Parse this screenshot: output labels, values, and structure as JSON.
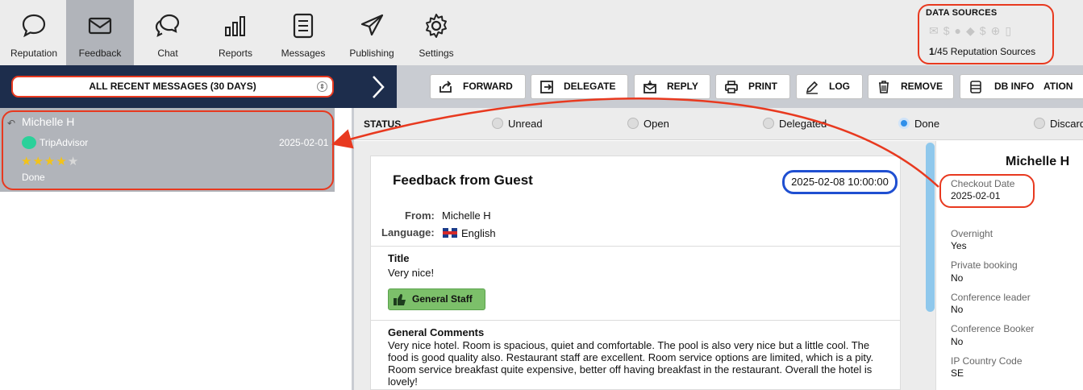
{
  "nav": {
    "items": [
      {
        "label": "Reputation",
        "icon": "speech-bubble-icon"
      },
      {
        "label": "Feedback",
        "icon": "envelope-icon"
      },
      {
        "label": "Chat",
        "icon": "chat-bubbles-icon"
      },
      {
        "label": "Reports",
        "icon": "bar-chart-icon"
      },
      {
        "label": "Messages",
        "icon": "document-icon"
      },
      {
        "label": "Publishing",
        "icon": "paper-plane-icon"
      },
      {
        "label": "Settings",
        "icon": "gear-icon"
      }
    ],
    "active": "Feedback"
  },
  "data_sources": {
    "title": "DATA SOURCES",
    "active_count": "1",
    "count_rest": "/45 Reputation Sources"
  },
  "toolbar": {
    "filter_label": "ALL RECENT MESSAGES (30 DAYS)",
    "buttons": {
      "forward": "FORWARD",
      "delegate": "DELEGATE",
      "reply": "REPLY",
      "print": "PRINT",
      "log": "LOG",
      "remove": "REMOVE",
      "db_info": "DB INFO",
      "truncated": "ATION"
    }
  },
  "message_list": [
    {
      "name": "Michelle H",
      "source": "TripAdvisor",
      "date": "2025-02-01",
      "rating": 4,
      "rating_max": 5,
      "status": "Done"
    }
  ],
  "status": {
    "label": "STATUS",
    "options": [
      "Unread",
      "Open",
      "Delegated",
      "Done",
      "Discard"
    ],
    "selected": "Done"
  },
  "feedback": {
    "title": "Feedback from Guest",
    "datetime": "2025-02-08 10:00:00",
    "from_label": "From:",
    "from_value": "Michelle H",
    "language_label": "Language:",
    "language_value": "English",
    "title_label": "Title",
    "title_value": "Very nice!",
    "tag": "General Staff",
    "comments_label": "General Comments",
    "comments": "Very nice hotel. Room is spacious, quiet and comfortable. The pool is also very nice but a little cool. The food is good quality also. Restaurant staff are excellent. Room service options are limited, which is a pity. Room service breakfast quite expensive, better off having breakfast in the restaurant. Overall the hotel is lovely!"
  },
  "guest": {
    "name": "Michelle H",
    "fields": [
      {
        "label": "Checkout Date",
        "value": "2025-02-01"
      },
      {
        "label": "Overnight",
        "value": "Yes"
      },
      {
        "label": "Private booking",
        "value": "No"
      },
      {
        "label": "Conference leader",
        "value": "No"
      },
      {
        "label": "Conference Booker",
        "value": "No"
      },
      {
        "label": "IP Country Code",
        "value": "SE"
      }
    ]
  },
  "colors": {
    "highlight_red": "#e8391f",
    "highlight_blue": "#1f4fd1",
    "nav_dark": "#1d2d4c",
    "selected_row": "#b1b4ba",
    "tag_green": "#7cc06a",
    "star_gold": "#f3c318"
  }
}
